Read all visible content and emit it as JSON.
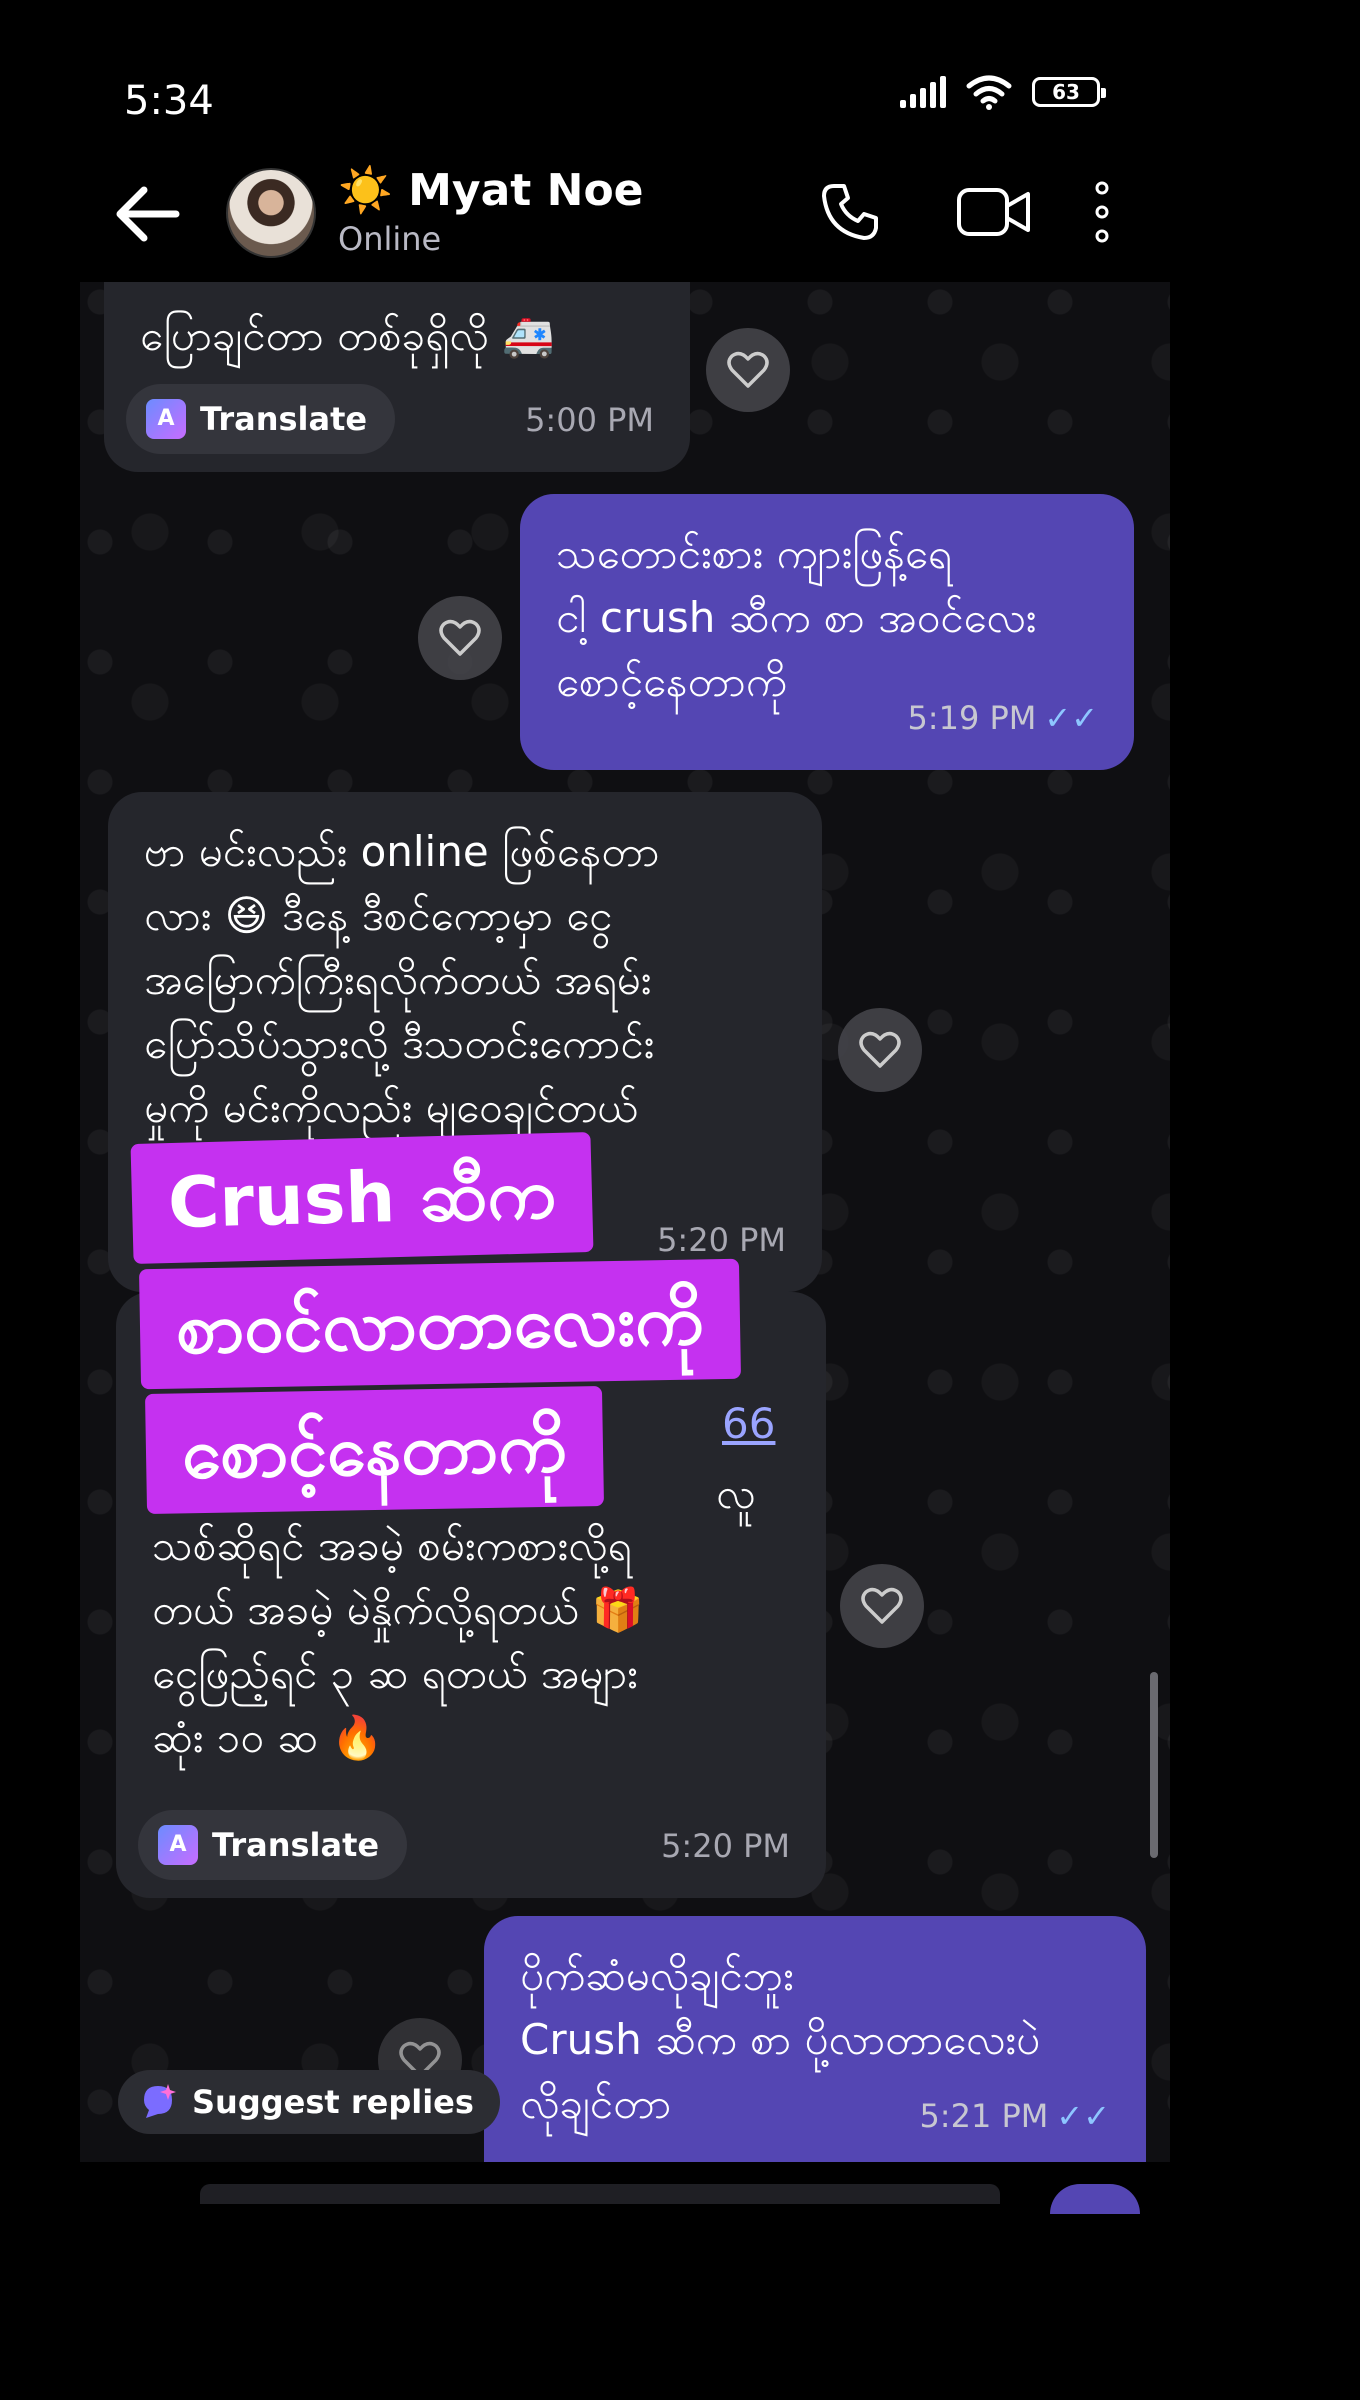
{
  "status_bar": {
    "time": "5:34",
    "battery": "63"
  },
  "header": {
    "contact_name": "☀️ Myat Noe",
    "contact_status": "Online"
  },
  "messages": [
    {
      "direction": "in",
      "text": "ပြောချင်တာ တစ်ခုရှိလို 🚑",
      "translate_label": "Translate",
      "time": "5:00 PM"
    },
    {
      "direction": "out",
      "text": "သတောင်းစား ကျားဖြန့်ရေ\nငါ့ crush ဆီက စာ အဝင်လေး\nစောင့်နေတာကို",
      "time": "5:19 PM",
      "ticks": "✓✓"
    },
    {
      "direction": "in",
      "text": "ဗာ မင်းလည်း online ဖြစ်နေတာ\nလား 😆 ဒီနေ့ ဒီစင်ကော့မှာ ငွေ\nအမြောက်ကြီးရလိုက်တယ် အရမ်း\nပြော်သိပ်သွားလို့ ဒီသတင်းကောင်း\nမှုကို မင်းကိုလည်း မျဝေချင်တယ်",
      "time": "5:20 PM"
    },
    {
      "direction": "in",
      "link_text": "66",
      "partial_text": "လူ",
      "text": "သစ်ဆိုရင် အခမဲ့ စမ်းကစားလို့ရ\nတယ် အခမဲ့ မဲနှိုက်လို့ရတယ် 🎁\nငွေဖြည့်ရင် ၃ ဆ ရတယ် အများ\nဆုံး ၁၀ ဆ 🔥",
      "translate_label": "Translate",
      "time": "5:20 PM"
    },
    {
      "direction": "out",
      "text": "ပိုက်ဆံမလိုချင်ဘူး\nCrush ဆီက စာ ပို့လာတာလေးပဲ\nလိုချင်တာ",
      "time": "5:21 PM",
      "ticks": "✓✓"
    }
  ],
  "overlay": {
    "line1": "Crush ဆီက",
    "line2": "စာဝင်လာတာလေးကို",
    "line3": "စောင့်နေတာကို"
  },
  "suggest_replies_label": "Suggest replies",
  "icons": {
    "back": "back-arrow-icon",
    "call": "phone-icon",
    "video": "video-camera-icon",
    "more": "more-vertical-icon",
    "heart": "heart-icon",
    "translate": "translate-icon",
    "suggest": "sparkle-chat-icon"
  },
  "colors": {
    "outgoing_bubble": "#5446b3",
    "incoming_bubble": "#25262c",
    "overlay": "#c531f0",
    "read_ticks": "#8ec6ff"
  }
}
